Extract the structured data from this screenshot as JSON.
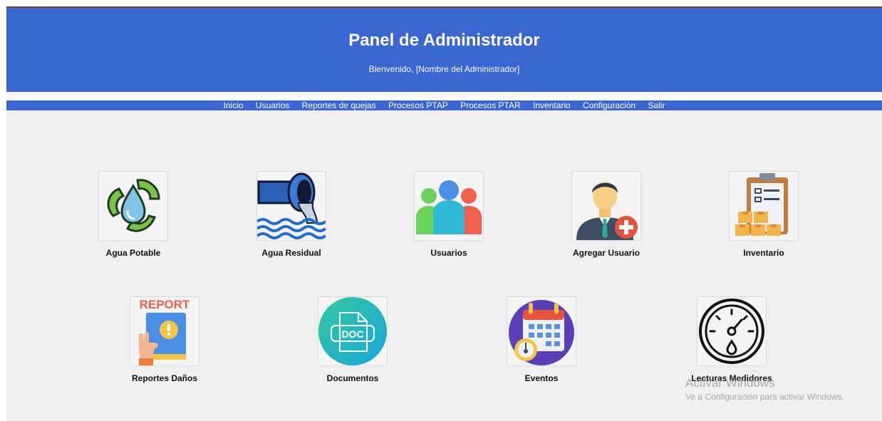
{
  "header": {
    "title": "Panel de Administrador",
    "subtitle": "Bienvenido, [Nombre del Administrador]"
  },
  "nav": [
    "Inicio",
    "Usuarios",
    "Reportes de quejas",
    "Procesos PTAP",
    "Procesos PTAR",
    "Inventario",
    "Configuración",
    "Salir"
  ],
  "cards": [
    {
      "label": "Agua Potable",
      "icon": "recycle-water-drop-icon"
    },
    {
      "label": "Agua Residual",
      "icon": "wastewater-pipe-icon"
    },
    {
      "label": "Usuarios",
      "icon": "users-group-icon"
    },
    {
      "label": "Agregar Usuario",
      "icon": "add-user-icon"
    },
    {
      "label": "Inventario",
      "icon": "inventory-clipboard-icon"
    },
    {
      "label": "Reportes Daños",
      "icon": "report-icon"
    },
    {
      "label": "Documentos",
      "icon": "doc-file-icon"
    },
    {
      "label": "Eventos",
      "icon": "calendar-icon"
    },
    {
      "label": "Lecturas Medidores",
      "icon": "meter-gauge-icon"
    }
  ],
  "watermark": {
    "line1": "Activar Windows",
    "line2": "Ve a Configuración para activar Windows."
  },
  "colors": {
    "header_bg": "#3a66d1",
    "content_bg": "#efefef"
  }
}
